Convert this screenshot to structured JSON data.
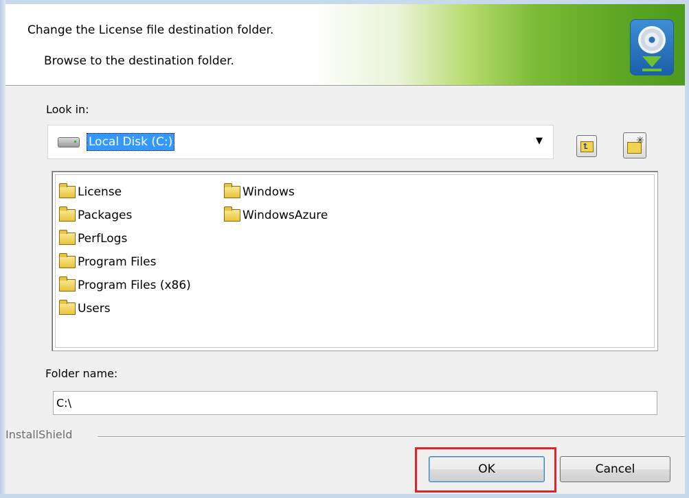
{
  "header": {
    "title": "Change the License file destination folder.",
    "subtitle": "Browse to the destination folder."
  },
  "look_in": {
    "label": "Look in:",
    "selected": "Local Disk (C:)"
  },
  "toolbar": {
    "up_icon": "up-one-level-icon",
    "new_folder_icon": "new-folder-icon"
  },
  "folders": {
    "column1": [
      "License",
      "Packages",
      "PerfLogs",
      "Program Files",
      "Program Files (x86)",
      "Users"
    ],
    "column2": [
      "Windows",
      "WindowsAzure"
    ]
  },
  "folder_name": {
    "label": "Folder name:",
    "value": "C:\\"
  },
  "branding": "InstallShield",
  "buttons": {
    "ok": "OK",
    "cancel": "Cancel"
  },
  "colors": {
    "selection": "#3399ff",
    "highlight_box": "#e0242c"
  }
}
